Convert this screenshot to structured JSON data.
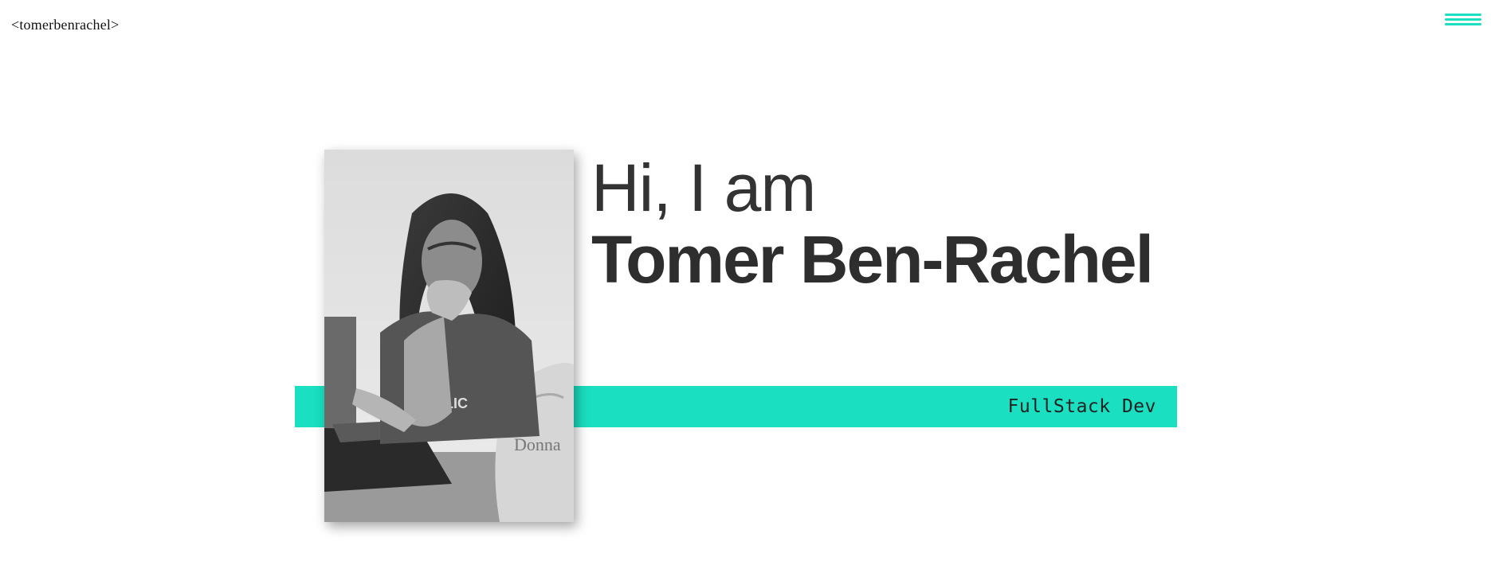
{
  "header": {
    "logo_text": "<tomerbenrachel>",
    "menu_icon": "hamburger-icon"
  },
  "hero": {
    "greeting": "Hi, I am",
    "name": "Tomer Ben-Rachel",
    "role": "FullStack Dev",
    "photo_alt": "Portrait of Tomer Ben-Rachel",
    "photo_shirt_text": "FLIC",
    "photo_bag_text": "Donna"
  },
  "colors": {
    "accent": "#1adfc0",
    "text_dark": "#2e2e2e",
    "background": "#ffffff"
  }
}
